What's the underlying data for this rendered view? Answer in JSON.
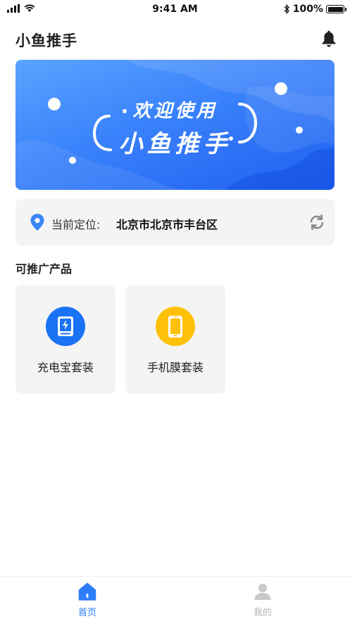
{
  "status_bar": {
    "time": "9:41 AM",
    "battery": "100%"
  },
  "header": {
    "title": "小鱼推手"
  },
  "banner": {
    "line1": "欢迎使用",
    "line2": "小鱼推手"
  },
  "location": {
    "label": "当前定位:",
    "value": "北京市北京市丰台区"
  },
  "section": {
    "title": "可推广产品"
  },
  "products": [
    {
      "label": "充电宝套装",
      "icon": "power-bank-icon",
      "color": "#1a73f5"
    },
    {
      "label": "手机膜套装",
      "icon": "phone-film-icon",
      "color": "#ffc107"
    }
  ],
  "tabs": [
    {
      "label": "首页",
      "icon": "home-icon",
      "active": true
    },
    {
      "label": "我的",
      "icon": "user-icon",
      "active": false
    }
  ],
  "colors": {
    "accent": "#2c7ef8",
    "inactive": "#b5b5b5",
    "card_bg": "#f4f4f4"
  }
}
